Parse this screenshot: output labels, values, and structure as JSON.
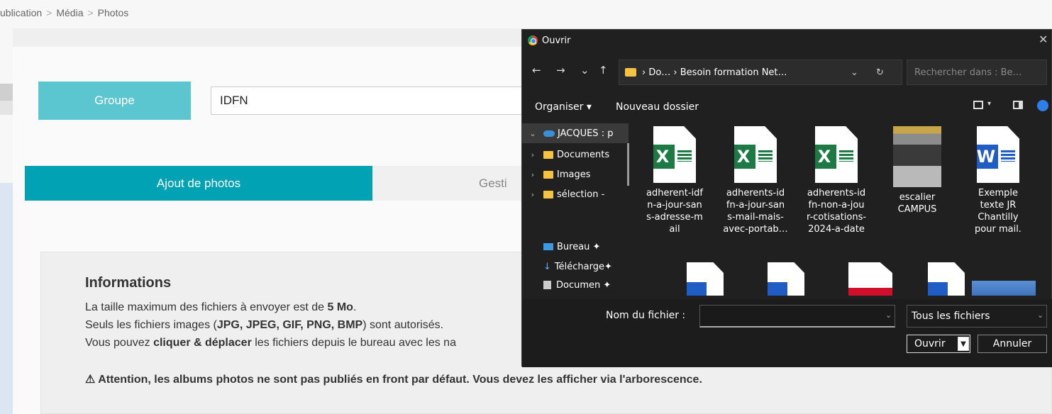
{
  "breadcrumb": {
    "items": [
      "ublication",
      "Média",
      "Photos"
    ],
    "separator": ">"
  },
  "groupe": {
    "label": "Groupe",
    "value": "IDFN"
  },
  "tabs": {
    "ajout": "Ajout de photos",
    "gestion": "Gesti"
  },
  "info": {
    "title": "Informations",
    "line1_pre": "La taille maximum des fichiers à envoyer est de ",
    "line1_bold": "5 Mo",
    "line1_post": ".",
    "line2_pre": "Seuls les fichiers images (",
    "line2_bold": "JPG, JPEG, GIF, PNG, BMP",
    "line2_post": ") sont autorisés.",
    "line3_pre": "Vous pouvez ",
    "line3_bold": "cliquer & déplacer",
    "line3_post": " les fichiers depuis le bureau avec les na",
    "attention": "⚠ Attention, les albums photos ne sont pas publiés en front par défaut. Vous devez les afficher via l'arborescence."
  },
  "dialog": {
    "title": "Ouvrir",
    "close": "✕",
    "nav": {
      "back": "←",
      "forward": "→",
      "recent": "⌄",
      "up": "↑"
    },
    "address": "› Do… › Besoin formation Net…",
    "address_dropdown": "⌄",
    "refresh": "↻",
    "search_placeholder": "Rechercher dans : Be…",
    "toolbar": {
      "organize": "Organiser ▾",
      "new_folder": "Nouveau dossier"
    },
    "nav_items": [
      {
        "label": "JACQUES : p",
        "chev": "⌄"
      },
      {
        "label": "Documents",
        "chev": "›"
      },
      {
        "label": "Images",
        "chev": "›"
      },
      {
        "label": "sélection -",
        "chev": "›"
      },
      {
        "label": "Bureau ✦",
        "chev": ""
      },
      {
        "label": "Télécharge✦",
        "chev": ""
      },
      {
        "label": "Documen ✦",
        "chev": ""
      }
    ],
    "files": [
      {
        "name": "adherent-idfn-a-jour-sans-adresse-mail",
        "lines": [
          "adherent-idf",
          "n-a-jour-san",
          "s-adresse-m",
          "ail"
        ],
        "type": "excel"
      },
      {
        "name": "adherents-idfn-a-jour-sans-mail-mais-avec-portab…",
        "lines": [
          "adherents-id",
          "fn-a-jour-san",
          "s-mail-mais-",
          "avec-portab…"
        ],
        "type": "excel"
      },
      {
        "name": "adherents-idfn-non-a-jour-cotisations-2024-a-date",
        "lines": [
          "adherents-id",
          "fn-non-a-jou",
          "r-cotisations-",
          "2024-a-date"
        ],
        "type": "excel"
      },
      {
        "name": "escalier CAMPUS",
        "lines": [
          "escalier",
          "CAMPUS"
        ],
        "type": "photo"
      },
      {
        "name": "Exemple texte JR Chantilly pour mail.",
        "lines": [
          "Exemple",
          "texte JR",
          "Chantilly",
          "pour mail."
        ],
        "type": "word"
      }
    ],
    "excel_letter": "X",
    "word_letter": "W",
    "filename_label": "Nom du fichier :",
    "filename_value": "",
    "filetype": "Tous les fichiers",
    "open": "Ouvrir",
    "cancel": "Annuler"
  }
}
